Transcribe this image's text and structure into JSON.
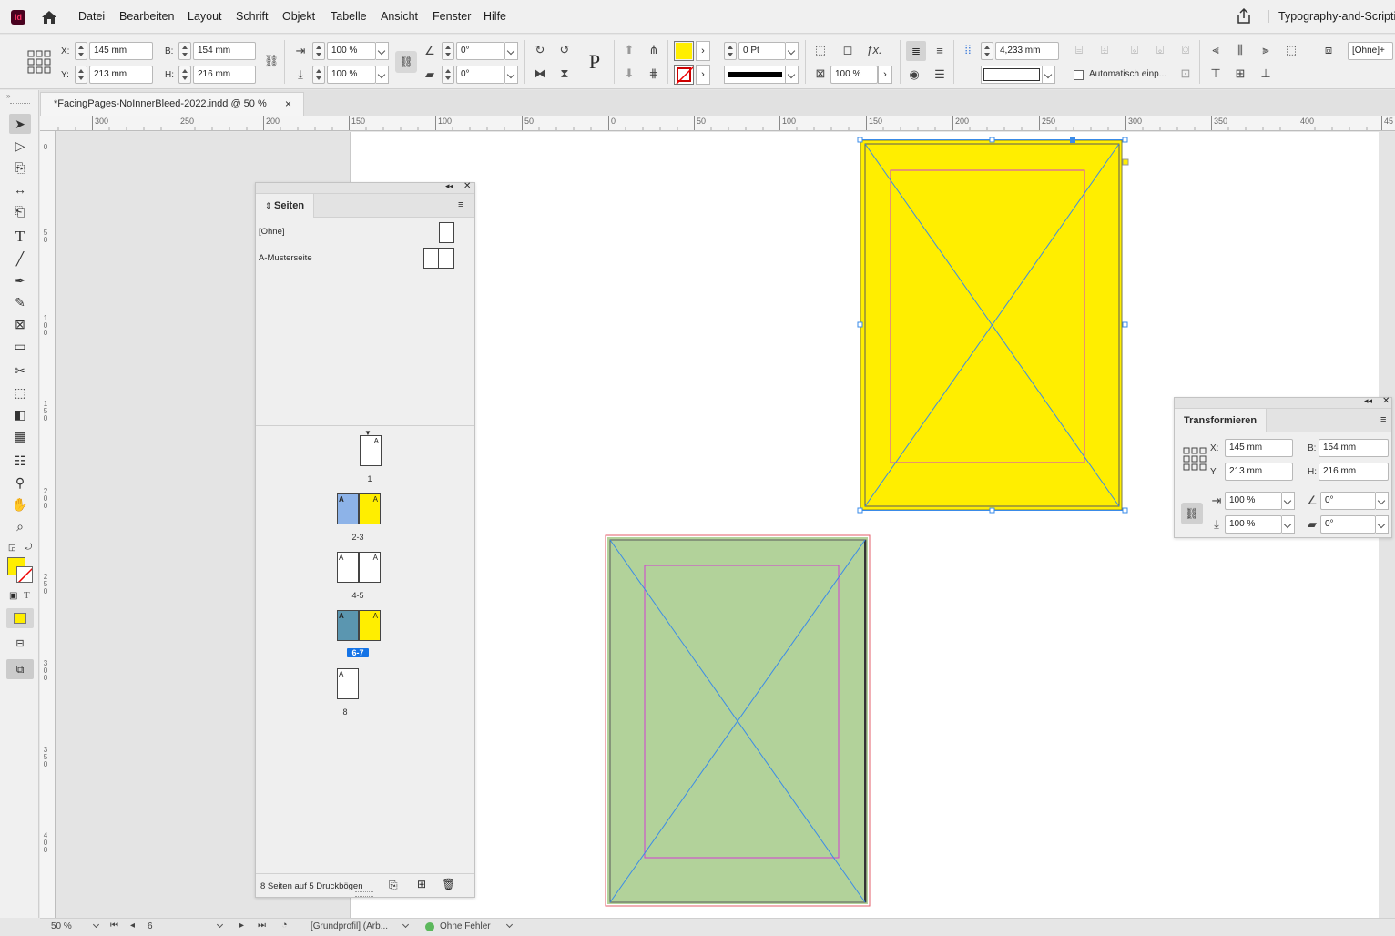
{
  "app": {
    "logo": "Id",
    "menu": [
      "Datei",
      "Bearbeiten",
      "Layout",
      "Schrift",
      "Objekt",
      "Tabelle",
      "Ansicht",
      "Fenster",
      "Hilfe"
    ],
    "workspace": "Typography-and-Scripti"
  },
  "control": {
    "x_label": "X:",
    "x_value": "145 mm",
    "y_label": "Y:",
    "y_value": "213 mm",
    "w_label": "B:",
    "w_value": "154 mm",
    "h_label": "H:",
    "h_value": "216 mm",
    "scale_x": "100 %",
    "scale_y": "100 %",
    "rotate": "0°",
    "shear": "0°",
    "stroke_weight": "0 Pt",
    "opacity": "100 %",
    "spacing": "4,233 mm",
    "auto_fit_label": "Automatisch einp...",
    "object_style": "[Ohne]+",
    "fill_color": "#ffee00"
  },
  "document_tab": {
    "title": "*FacingPages-NoInnerBleed-2022.indd @ 50 %",
    "close": "×"
  },
  "ruler": {
    "h_labels": [
      "300",
      "250",
      "200",
      "150",
      "100",
      "50",
      "0",
      "50",
      "100",
      "150",
      "200",
      "250",
      "300",
      "350",
      "400",
      "45"
    ],
    "v_labels": [
      "0",
      "5 0",
      "1 0 0",
      "1 5 0",
      "2 0 0",
      "2 5 0",
      "3 0 0",
      "3 5 0",
      "4 0 0"
    ]
  },
  "pages_panel": {
    "tab": "Seiten",
    "masters": [
      {
        "label": "[Ohne]"
      },
      {
        "label": "A-Musterseite"
      }
    ],
    "spreads": [
      {
        "label": "1",
        "selected": false,
        "left": null,
        "right": {
          "master": "A",
          "color": "#ffffff"
        }
      },
      {
        "label": "2-3",
        "selected": false,
        "left": {
          "master": "A",
          "color": "#8db3e8"
        },
        "right": {
          "master": "A",
          "color": "#ffee00"
        }
      },
      {
        "label": "4-5",
        "selected": false,
        "left": {
          "master": "A",
          "color": "#ffffff"
        },
        "right": {
          "master": "A",
          "color": "#ffffff"
        }
      },
      {
        "label": "6-7",
        "selected": true,
        "left": {
          "master": "A",
          "color": "#5b96b0"
        },
        "right": {
          "master": "A",
          "color": "#ffee00"
        }
      },
      {
        "label": "8",
        "selected": false,
        "left": {
          "master": "A",
          "color": "#ffffff"
        },
        "right": null
      }
    ],
    "footer": "8 Seiten auf 5 Druckbögen"
  },
  "transform_panel": {
    "title": "Transformieren",
    "x_label": "X:",
    "x_value": "145 mm",
    "y_label": "Y:",
    "y_value": "213 mm",
    "w_label": "B:",
    "w_value": "154 mm",
    "h_label": "H:",
    "h_value": "216 mm",
    "scale_x": "100 %",
    "scale_y": "100 %",
    "rotate": "0°",
    "shear": "0°"
  },
  "status": {
    "zoom": "50 %",
    "page": "6",
    "profile": "[Grundprofil] (Arb...",
    "preflight": "Ohne Fehler"
  },
  "colors": {
    "yellow_frame": "#ffee00",
    "green_frame": "#b2d29a",
    "selection": "#3a8be8",
    "margin": "#d23fd2"
  }
}
